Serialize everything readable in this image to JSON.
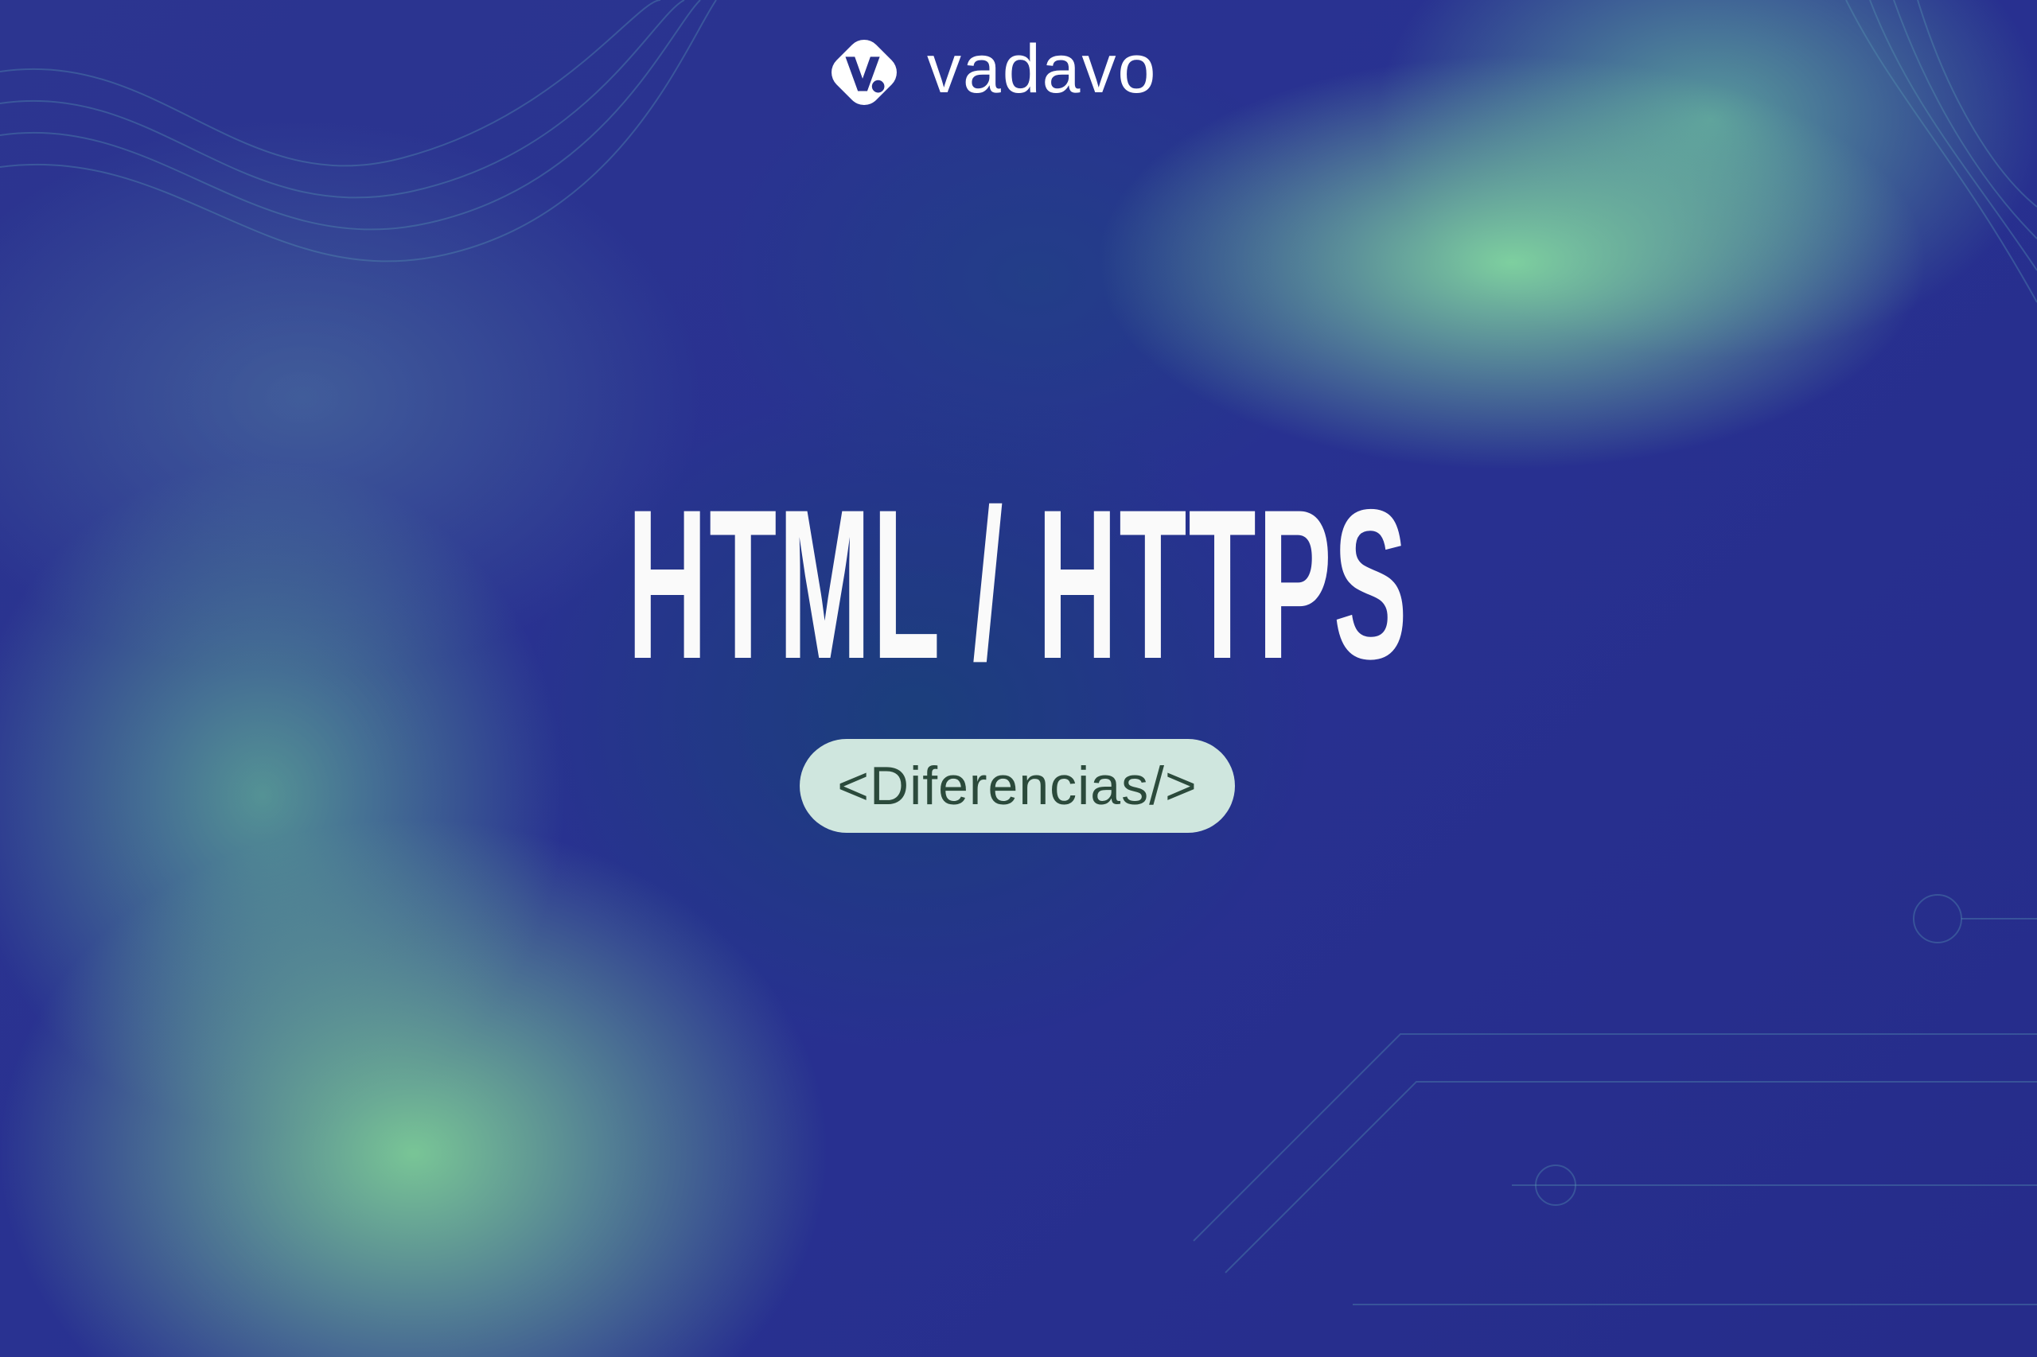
{
  "brand": {
    "name": "vadavo",
    "logo_icon": "vadavo-v-logo"
  },
  "title": "HTML / HTTPS",
  "tag": "<Diferencias/>",
  "colors": {
    "background": "#27308a",
    "accent_green": "#82d7a0",
    "pill_bg": "#cfe6de",
    "pill_text": "#2b4a3b"
  }
}
